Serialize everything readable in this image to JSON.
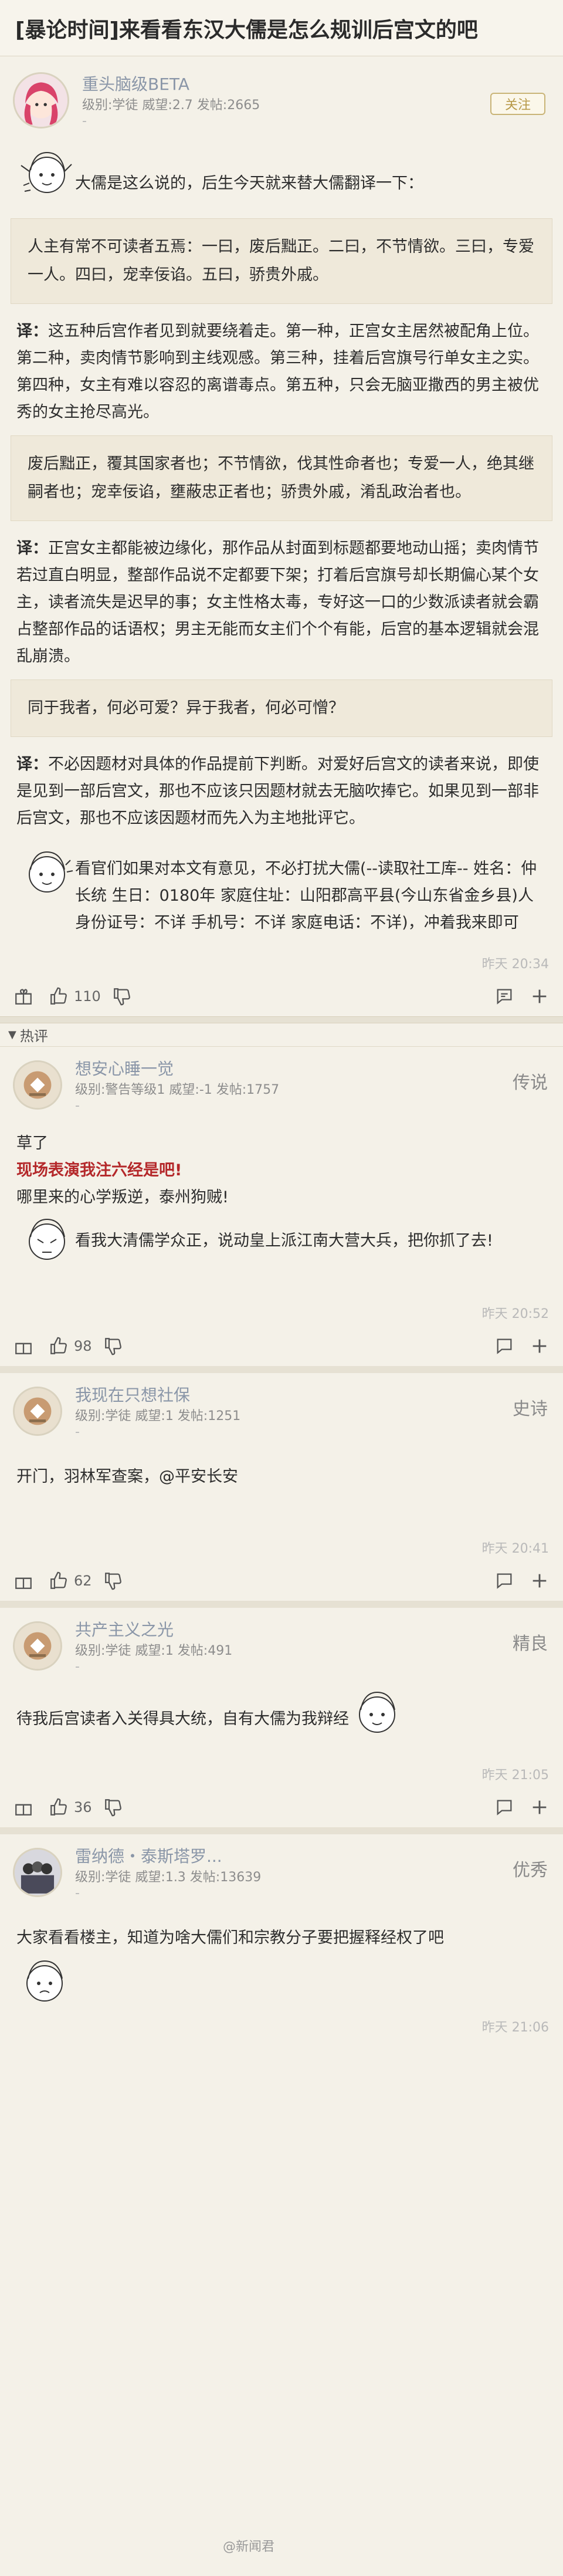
{
  "title": "[暴论时间]来看看东汉大儒是怎么规训后宫文的吧",
  "op": {
    "name": "重头脑级BETA",
    "meta": "级别:学徒 威望:2.7 发帖:2665",
    "sub": "-",
    "follow_label": "关注",
    "intro": "大儒是这么说的，后生今天就来替大儒翻译一下：",
    "quote1": "人主有常不可读者五焉：一曰，废后黜正。二曰，不节情欲。三曰，专爱一人。四曰，宠幸佞谄。五曰，骄贵外戚。",
    "trans1_label": "译：",
    "trans1": "这五种后宫作者见到就要绕着走。第一种，正宫女主居然被配角上位。第二种，卖肉情节影响到主线观感。第三种，挂着后宫旗号行单女主之实。第四种，女主有难以容忍的离谱毒点。第五种，只会无脑亚撒西的男主被优秀的女主抢尽高光。",
    "quote2": "废后黜正，覆其国家者也；不节情欲，伐其性命者也；专爱一人，绝其继嗣者也；宠幸佞谄，壅蔽忠正者也；骄贵外戚，淆乱政治者也。",
    "trans2_label": "译：",
    "trans2": "正宫女主都能被边缘化，那作品从封面到标题都要地动山摇；卖肉情节若过直白明显，整部作品说不定都要下架；打着后宫旗号却长期偏心某个女主，读者流失是迟早的事；女主性格太毒，专好这一口的少数派读者就会霸占整部作品的话语权；男主无能而女主们个个有能，后宫的基本逻辑就会混乱崩溃。",
    "quote3": "同于我者，何必可爱？异于我者，何必可憎？",
    "trans3_label": "译：",
    "trans3": "不必因题材对具体的作品提前下判断。对爱好后宫文的读者来说，即使是见到一部后宫文，那也不应该只因题材就去无脑吹捧它。如果见到一部非后宫文，那也不应该因题材而先入为主地批评它。",
    "outro": "看官们如果对本文有意见，不必打扰大儒(--读取社工库-- 姓名：仲长统 生日：0180年 家庭住址：山阳郡高平县(今山东省金乡县)人 身份证号：不详 手机号：不详 家庭电话：不详)，冲着我来即可",
    "time": "昨天 20:34",
    "likes": "110"
  },
  "hot_label": "热评",
  "replies": [
    {
      "name": "想安心睡一觉",
      "meta": "级别:警告等级1 威望:-1 发帖:1757",
      "sub": "-",
      "tag": "传说",
      "line1": "草了",
      "line2": "现场表演我注六经是吧!",
      "line3": "哪里来的心学叛逆，泰州狗贼!",
      "line4": "看我大清儒学众正，说动皇上派江南大营大兵，把你抓了去!",
      "time": "昨天 20:52",
      "likes": "98"
    },
    {
      "name": "我现在只想社保",
      "meta": "级别:学徒 威望:1 发帖:1251",
      "sub": "-",
      "tag": "史诗",
      "line1": "开门，羽林军查案，@平安长安",
      "time": "昨天 20:41",
      "likes": "62"
    },
    {
      "name": "共产主义之光",
      "meta": "级别:学徒 威望:1 发帖:491",
      "sub": "-",
      "tag": "精良",
      "line1": "待我后宫读者入关得具大统，自有大儒为我辩经",
      "time": "昨天 21:05",
      "likes": "36"
    },
    {
      "name": "雷纳德・泰斯塔罗...",
      "meta": "级别:学徒 威望:1.3 发帖:13639",
      "sub": "-",
      "tag": "优秀",
      "line1": "大家看看楼主，知道为啥大儒们和宗教分子要把握释经权了吧",
      "time": "昨天 21:06"
    }
  ],
  "watermark": "@新闻君"
}
